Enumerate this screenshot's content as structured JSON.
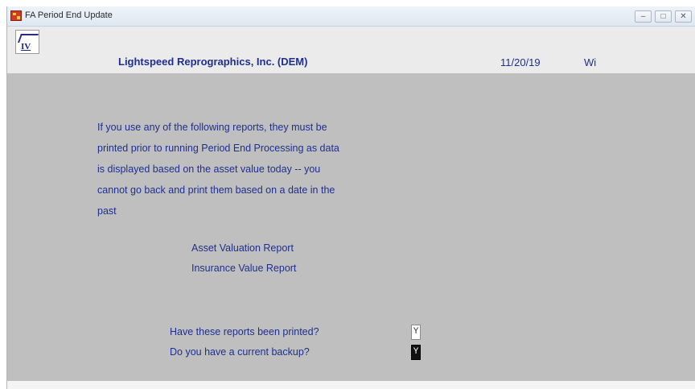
{
  "window": {
    "title": "FA Period End Update"
  },
  "header": {
    "logo_text": "IV",
    "company": "Lightspeed Reprographics, Inc. (DEM)",
    "date": "11/20/19",
    "user": "Wi"
  },
  "message": {
    "lines": [
      "If you use any of the following reports, they must be",
      "printed prior to running Period End Processing as data",
      "is displayed based on the asset value today -- you",
      "cannot go back and print them based on a date in the",
      "past"
    ]
  },
  "reports": [
    "Asset Valuation Report",
    "Insurance Value Report"
  ],
  "questions": [
    {
      "label": "Have these reports been printed?",
      "value": "Y"
    },
    {
      "label": "Do you have a current backup?",
      "value": "Y"
    }
  ]
}
